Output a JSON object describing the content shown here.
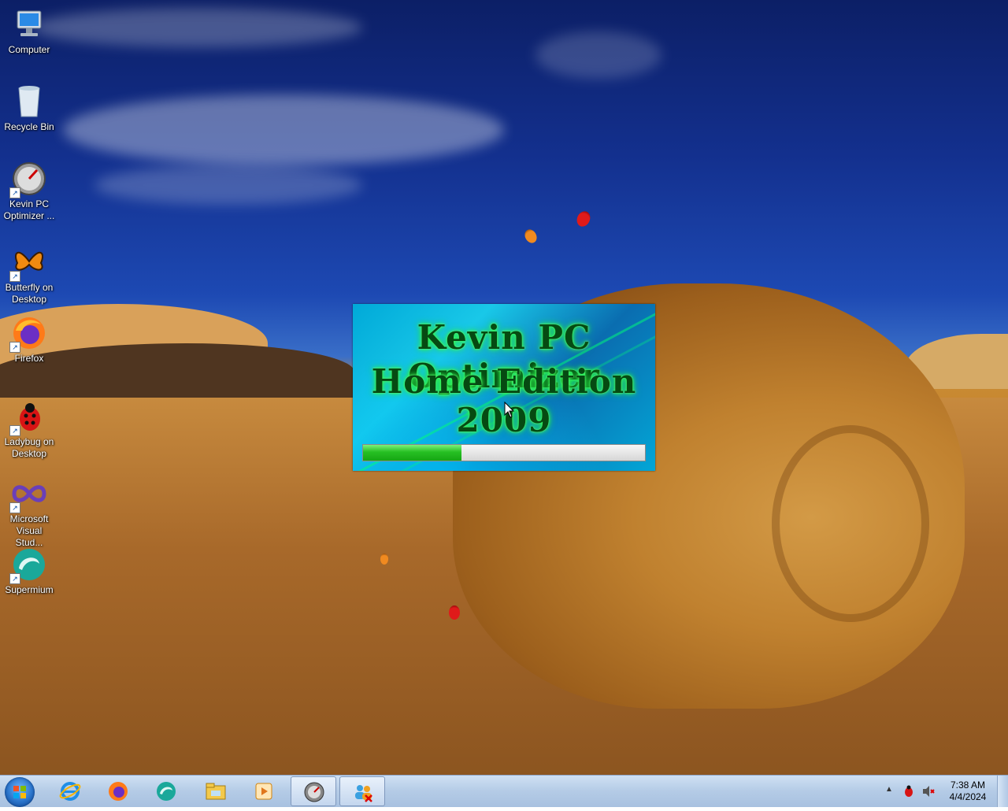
{
  "desktop": {
    "icons": [
      {
        "label": "Computer",
        "icon": "computer-icon"
      },
      {
        "label": "Recycle Bin",
        "icon": "recycle-bin-icon"
      },
      {
        "label": "Kevin PC Optimizer ...",
        "icon": "speedometer-icon"
      },
      {
        "label": "Butterfly on Desktop",
        "icon": "butterfly-icon"
      },
      {
        "label": "Firefox",
        "icon": "firefox-icon"
      },
      {
        "label": "Ladybug on Desktop",
        "icon": "ladybug-icon"
      },
      {
        "label": "Microsoft Visual Stud...",
        "icon": "visual-studio-icon"
      },
      {
        "label": "Supermium",
        "icon": "supermium-icon"
      }
    ]
  },
  "splash": {
    "title_line1": "Kevin PC Optimizer",
    "title_line2": "Home Edition 2009",
    "progress": 0.35
  },
  "taskbar": {
    "buttons": [
      {
        "icon": "internet-explorer-icon"
      },
      {
        "icon": "firefox-icon"
      },
      {
        "icon": "supermium-icon"
      },
      {
        "icon": "file-explorer-icon"
      },
      {
        "icon": "media-player-icon"
      },
      {
        "icon": "speedometer-icon",
        "active": true
      },
      {
        "icon": "users-icon"
      }
    ],
    "clock_time": "7:38 AM",
    "clock_date": "4/4/2024"
  }
}
